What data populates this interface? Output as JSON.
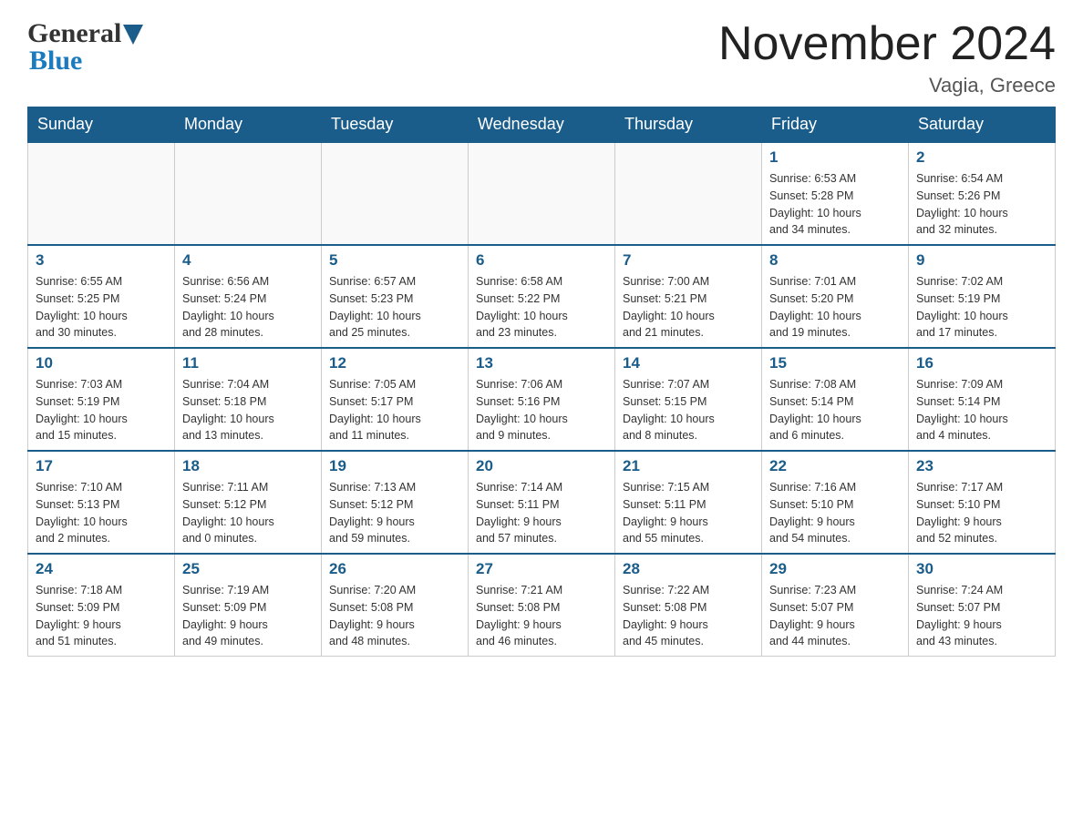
{
  "header": {
    "logo_general": "General",
    "logo_blue": "Blue",
    "month_title": "November 2024",
    "location": "Vagia, Greece"
  },
  "calendar": {
    "days_of_week": [
      "Sunday",
      "Monday",
      "Tuesday",
      "Wednesday",
      "Thursday",
      "Friday",
      "Saturday"
    ],
    "weeks": [
      {
        "days": [
          {
            "number": "",
            "info": ""
          },
          {
            "number": "",
            "info": ""
          },
          {
            "number": "",
            "info": ""
          },
          {
            "number": "",
            "info": ""
          },
          {
            "number": "",
            "info": ""
          },
          {
            "number": "1",
            "info": "Sunrise: 6:53 AM\nSunset: 5:28 PM\nDaylight: 10 hours\nand 34 minutes."
          },
          {
            "number": "2",
            "info": "Sunrise: 6:54 AM\nSunset: 5:26 PM\nDaylight: 10 hours\nand 32 minutes."
          }
        ]
      },
      {
        "days": [
          {
            "number": "3",
            "info": "Sunrise: 6:55 AM\nSunset: 5:25 PM\nDaylight: 10 hours\nand 30 minutes."
          },
          {
            "number": "4",
            "info": "Sunrise: 6:56 AM\nSunset: 5:24 PM\nDaylight: 10 hours\nand 28 minutes."
          },
          {
            "number": "5",
            "info": "Sunrise: 6:57 AM\nSunset: 5:23 PM\nDaylight: 10 hours\nand 25 minutes."
          },
          {
            "number": "6",
            "info": "Sunrise: 6:58 AM\nSunset: 5:22 PM\nDaylight: 10 hours\nand 23 minutes."
          },
          {
            "number": "7",
            "info": "Sunrise: 7:00 AM\nSunset: 5:21 PM\nDaylight: 10 hours\nand 21 minutes."
          },
          {
            "number": "8",
            "info": "Sunrise: 7:01 AM\nSunset: 5:20 PM\nDaylight: 10 hours\nand 19 minutes."
          },
          {
            "number": "9",
            "info": "Sunrise: 7:02 AM\nSunset: 5:19 PM\nDaylight: 10 hours\nand 17 minutes."
          }
        ]
      },
      {
        "days": [
          {
            "number": "10",
            "info": "Sunrise: 7:03 AM\nSunset: 5:19 PM\nDaylight: 10 hours\nand 15 minutes."
          },
          {
            "number": "11",
            "info": "Sunrise: 7:04 AM\nSunset: 5:18 PM\nDaylight: 10 hours\nand 13 minutes."
          },
          {
            "number": "12",
            "info": "Sunrise: 7:05 AM\nSunset: 5:17 PM\nDaylight: 10 hours\nand 11 minutes."
          },
          {
            "number": "13",
            "info": "Sunrise: 7:06 AM\nSunset: 5:16 PM\nDaylight: 10 hours\nand 9 minutes."
          },
          {
            "number": "14",
            "info": "Sunrise: 7:07 AM\nSunset: 5:15 PM\nDaylight: 10 hours\nand 8 minutes."
          },
          {
            "number": "15",
            "info": "Sunrise: 7:08 AM\nSunset: 5:14 PM\nDaylight: 10 hours\nand 6 minutes."
          },
          {
            "number": "16",
            "info": "Sunrise: 7:09 AM\nSunset: 5:14 PM\nDaylight: 10 hours\nand 4 minutes."
          }
        ]
      },
      {
        "days": [
          {
            "number": "17",
            "info": "Sunrise: 7:10 AM\nSunset: 5:13 PM\nDaylight: 10 hours\nand 2 minutes."
          },
          {
            "number": "18",
            "info": "Sunrise: 7:11 AM\nSunset: 5:12 PM\nDaylight: 10 hours\nand 0 minutes."
          },
          {
            "number": "19",
            "info": "Sunrise: 7:13 AM\nSunset: 5:12 PM\nDaylight: 9 hours\nand 59 minutes."
          },
          {
            "number": "20",
            "info": "Sunrise: 7:14 AM\nSunset: 5:11 PM\nDaylight: 9 hours\nand 57 minutes."
          },
          {
            "number": "21",
            "info": "Sunrise: 7:15 AM\nSunset: 5:11 PM\nDaylight: 9 hours\nand 55 minutes."
          },
          {
            "number": "22",
            "info": "Sunrise: 7:16 AM\nSunset: 5:10 PM\nDaylight: 9 hours\nand 54 minutes."
          },
          {
            "number": "23",
            "info": "Sunrise: 7:17 AM\nSunset: 5:10 PM\nDaylight: 9 hours\nand 52 minutes."
          }
        ]
      },
      {
        "days": [
          {
            "number": "24",
            "info": "Sunrise: 7:18 AM\nSunset: 5:09 PM\nDaylight: 9 hours\nand 51 minutes."
          },
          {
            "number": "25",
            "info": "Sunrise: 7:19 AM\nSunset: 5:09 PM\nDaylight: 9 hours\nand 49 minutes."
          },
          {
            "number": "26",
            "info": "Sunrise: 7:20 AM\nSunset: 5:08 PM\nDaylight: 9 hours\nand 48 minutes."
          },
          {
            "number": "27",
            "info": "Sunrise: 7:21 AM\nSunset: 5:08 PM\nDaylight: 9 hours\nand 46 minutes."
          },
          {
            "number": "28",
            "info": "Sunrise: 7:22 AM\nSunset: 5:08 PM\nDaylight: 9 hours\nand 45 minutes."
          },
          {
            "number": "29",
            "info": "Sunrise: 7:23 AM\nSunset: 5:07 PM\nDaylight: 9 hours\nand 44 minutes."
          },
          {
            "number": "30",
            "info": "Sunrise: 7:24 AM\nSunset: 5:07 PM\nDaylight: 9 hours\nand 43 minutes."
          }
        ]
      }
    ]
  }
}
